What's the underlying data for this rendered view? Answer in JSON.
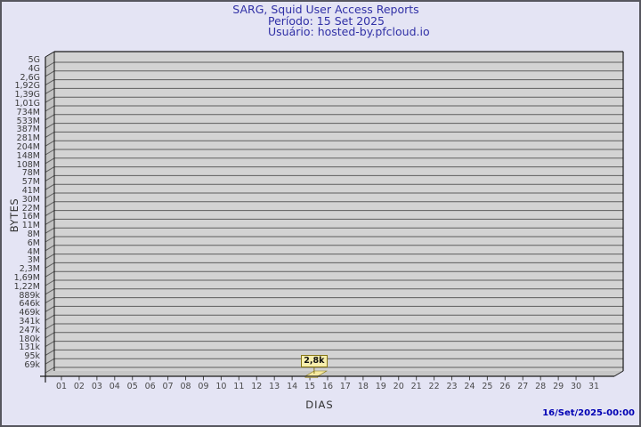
{
  "header": {
    "title": "SARG, Squid User Access Reports",
    "period_line": "Período: 15 Set 2025",
    "user_line": "Usuário: hosted-by.pfcloud.io"
  },
  "footer": {
    "timestamp": "16/Set/2025-00:00"
  },
  "colors": {
    "page_bg": "#e4e4f4",
    "page_border": "#56565e",
    "plot_bg": "#d3d3d3",
    "wall": "#c2c2c2",
    "floor": "#c6c6c6",
    "grid": "#5e5e5e",
    "frame": "#1a1a1a",
    "tick": "#444444",
    "title_text": "#3030a6",
    "timestamp_text": "#0000b4",
    "bar_fill": "#f5e9a0",
    "bar_border": "#867616",
    "value_label_bg": "#f7efad"
  },
  "chart_data": {
    "type": "bar",
    "title": "SARG, Squid User Access Reports",
    "subtitle_period": "Período: 15 Set 2025",
    "subtitle_user": "Usuário: hosted-by.pfcloud.io",
    "xlabel": "DIAS",
    "ylabel": "BYTES",
    "style": "3d-bar",
    "grid": true,
    "legend": null,
    "y_axis_type": "log",
    "y_ticks": [
      "5G",
      "4G",
      "2,6G",
      "1,92G",
      "1,39G",
      "1,01G",
      "734M",
      "533M",
      "387M",
      "281M",
      "204M",
      "148M",
      "108M",
      "78M",
      "57M",
      "41M",
      "30M",
      "22M",
      "16M",
      "11M",
      "8M",
      "6M",
      "4M",
      "3M",
      "2,3M",
      "1,69M",
      "1,22M",
      "889k",
      "646k",
      "469k",
      "341k",
      "247k",
      "180k",
      "131k",
      "95k",
      "69k"
    ],
    "categories": [
      "01",
      "02",
      "03",
      "04",
      "05",
      "06",
      "07",
      "08",
      "09",
      "10",
      "11",
      "12",
      "13",
      "14",
      "15",
      "16",
      "17",
      "18",
      "19",
      "20",
      "21",
      "22",
      "23",
      "24",
      "25",
      "26",
      "27",
      "28",
      "29",
      "30",
      "31"
    ],
    "values": [
      null,
      null,
      null,
      null,
      null,
      null,
      null,
      null,
      null,
      null,
      null,
      null,
      null,
      null,
      2800,
      null,
      null,
      null,
      null,
      null,
      null,
      null,
      null,
      null,
      null,
      null,
      null,
      null,
      null,
      null,
      null
    ],
    "point_labels": [
      {
        "category": "15",
        "label": "2,8k",
        "value": 2800
      }
    ]
  }
}
